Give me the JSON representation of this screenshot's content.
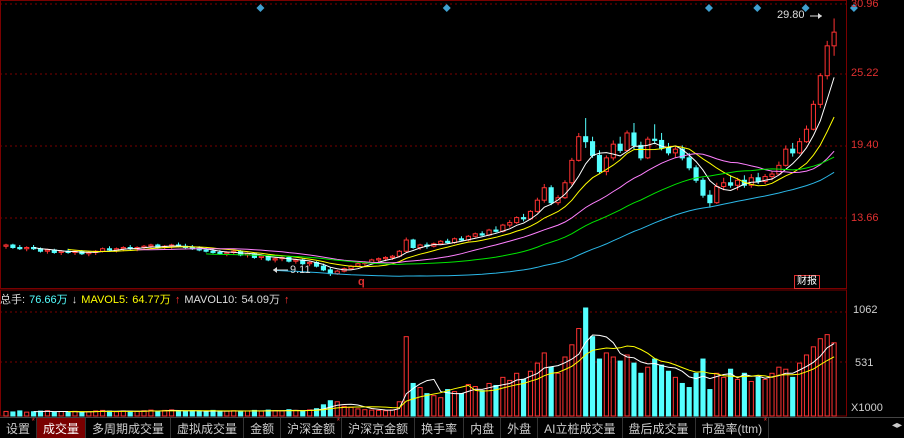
{
  "price_axis": [
    "30.96",
    "25.22",
    "19.40",
    "13.66"
  ],
  "volume_axis": [
    "1062",
    "531",
    "X1000"
  ],
  "annotations": {
    "high": "29.80",
    "low": "9.11",
    "event_marker": "q",
    "badge": "财报"
  },
  "indicator": {
    "total_label": "总手:",
    "total_value": "76.66万",
    "ma5_label": "MAVOL5:",
    "ma5_value": "64.77万",
    "ma10_label": "MAVOL10:",
    "ma10_value": "54.09万"
  },
  "tabs": [
    {
      "label": "设置",
      "star": true
    },
    {
      "label": "成交量",
      "active": true
    },
    {
      "label": "多周期成交量"
    },
    {
      "label": "虚拟成交量"
    },
    {
      "label": "金额"
    },
    {
      "label": "沪深金额",
      "star": true
    },
    {
      "label": "沪深京金额"
    },
    {
      "label": "换手率"
    },
    {
      "label": "内盘"
    },
    {
      "label": "外盘"
    },
    {
      "label": "AI立桩成交量"
    },
    {
      "label": "盘后成交量"
    },
    {
      "label": "市盈率(ttm)",
      "star": true
    }
  ],
  "nav_arrows": "◂▸",
  "colors": {
    "up": "#ff3232",
    "down": "#54ffff",
    "ma5": "#ffffff",
    "ma10": "#ffff00",
    "ma20": "#ff80ff",
    "ma30": "#00e600",
    "ma60": "#2bb8e8",
    "grid": "#7a0000",
    "diamond": "#3fa0d0"
  },
  "chart_data": {
    "type": "candlestick",
    "price_ylim": [
      9.11,
      30.96
    ],
    "volume_ylim": [
      0,
      1062
    ],
    "candles": [
      [
        11.5,
        11.7,
        11.3,
        11.6
      ],
      [
        11.6,
        11.7,
        11.3,
        11.4
      ],
      [
        11.4,
        11.6,
        11.2,
        11.3
      ],
      [
        11.3,
        11.5,
        11.1,
        11.4
      ],
      [
        11.4,
        11.6,
        11.2,
        11.3
      ],
      [
        11.3,
        11.4,
        11.0,
        11.1
      ],
      [
        11.1,
        11.3,
        10.9,
        11.2
      ],
      [
        11.2,
        11.3,
        10.9,
        11.0
      ],
      [
        11.0,
        11.2,
        10.8,
        11.1
      ],
      [
        11.1,
        11.3,
        10.9,
        11.0
      ],
      [
        11.0,
        11.2,
        10.8,
        11.1
      ],
      [
        11.1,
        11.2,
        10.8,
        10.9
      ],
      [
        10.9,
        11.1,
        10.7,
        11.0
      ],
      [
        11.0,
        11.2,
        10.8,
        11.1
      ],
      [
        11.1,
        11.4,
        11.0,
        11.3
      ],
      [
        11.3,
        11.5,
        11.1,
        11.2
      ],
      [
        11.2,
        11.4,
        11.0,
        11.3
      ],
      [
        11.3,
        11.5,
        11.1,
        11.4
      ],
      [
        11.4,
        11.6,
        11.2,
        11.3
      ],
      [
        11.3,
        11.5,
        11.1,
        11.4
      ],
      [
        11.4,
        11.6,
        11.2,
        11.5
      ],
      [
        11.5,
        11.7,
        11.3,
        11.6
      ],
      [
        11.6,
        11.7,
        11.3,
        11.4
      ],
      [
        11.4,
        11.6,
        11.2,
        11.5
      ],
      [
        11.5,
        11.7,
        11.3,
        11.6
      ],
      [
        11.6,
        11.8,
        11.4,
        11.5
      ],
      [
        11.5,
        11.7,
        11.3,
        11.4
      ],
      [
        11.4,
        11.6,
        11.2,
        11.3
      ],
      [
        11.3,
        11.5,
        11.1,
        11.2
      ],
      [
        11.2,
        11.4,
        11.0,
        11.1
      ],
      [
        11.1,
        11.3,
        10.9,
        11.0
      ],
      [
        11.0,
        11.2,
        10.8,
        10.9
      ],
      [
        10.9,
        11.1,
        10.7,
        11.0
      ],
      [
        11.0,
        11.2,
        10.8,
        11.1
      ],
      [
        11.1,
        11.2,
        10.7,
        10.8
      ],
      [
        10.8,
        11.0,
        10.6,
        10.9
      ],
      [
        10.9,
        11.0,
        10.5,
        10.6
      ],
      [
        10.6,
        10.8,
        10.4,
        10.7
      ],
      [
        10.7,
        10.8,
        10.3,
        10.4
      ],
      [
        10.4,
        10.6,
        10.2,
        10.5
      ],
      [
        10.5,
        10.7,
        10.3,
        10.6
      ],
      [
        10.6,
        10.7,
        10.2,
        10.3
      ],
      [
        10.3,
        10.5,
        10.1,
        10.4
      ],
      [
        10.4,
        10.5,
        10.0,
        10.1
      ],
      [
        10.1,
        10.3,
        9.9,
        10.2
      ],
      [
        10.2,
        10.3,
        9.8,
        9.9
      ],
      [
        9.9,
        10.1,
        9.5,
        9.6
      ],
      [
        9.6,
        9.8,
        9.11,
        9.3
      ],
      [
        9.3,
        9.6,
        9.2,
        9.5
      ],
      [
        9.5,
        9.8,
        9.4,
        9.7
      ],
      [
        9.7,
        10.0,
        9.6,
        9.9
      ],
      [
        9.9,
        10.2,
        9.8,
        10.1
      ],
      [
        10.1,
        10.3,
        9.9,
        10.2
      ],
      [
        10.2,
        10.5,
        10.1,
        10.4
      ],
      [
        10.4,
        10.6,
        10.2,
        10.5
      ],
      [
        10.5,
        10.7,
        10.3,
        10.6
      ],
      [
        10.6,
        10.8,
        10.4,
        10.7
      ],
      [
        10.7,
        11.2,
        10.6,
        11.1
      ],
      [
        11.1,
        12.2,
        11.0,
        12.0
      ],
      [
        12.0,
        12.1,
        11.3,
        11.4
      ],
      [
        11.4,
        11.7,
        11.2,
        11.6
      ],
      [
        11.6,
        11.8,
        11.3,
        11.5
      ],
      [
        11.5,
        11.8,
        11.4,
        11.7
      ],
      [
        11.7,
        12.0,
        11.6,
        11.9
      ],
      [
        11.9,
        12.1,
        11.7,
        11.8
      ],
      [
        11.8,
        12.2,
        11.7,
        12.1
      ],
      [
        12.1,
        12.3,
        11.9,
        12.0
      ],
      [
        12.0,
        12.4,
        11.9,
        12.3
      ],
      [
        12.3,
        12.6,
        12.2,
        12.5
      ],
      [
        12.5,
        12.7,
        12.3,
        12.4
      ],
      [
        12.4,
        12.9,
        12.3,
        12.8
      ],
      [
        12.8,
        13.1,
        12.6,
        12.7
      ],
      [
        12.7,
        13.3,
        12.6,
        13.2
      ],
      [
        13.2,
        13.6,
        13.0,
        13.4
      ],
      [
        13.4,
        13.9,
        13.3,
        13.8
      ],
      [
        13.8,
        14.1,
        13.5,
        13.7
      ],
      [
        13.7,
        14.4,
        13.6,
        14.3
      ],
      [
        14.3,
        15.4,
        14.2,
        15.2
      ],
      [
        15.2,
        16.5,
        15.0,
        16.2
      ],
      [
        16.2,
        16.4,
        14.8,
        15.0
      ],
      [
        15.0,
        15.6,
        14.8,
        15.4
      ],
      [
        15.4,
        16.8,
        15.3,
        16.6
      ],
      [
        16.6,
        18.6,
        16.4,
        18.4
      ],
      [
        18.4,
        20.6,
        18.3,
        20.3
      ],
      [
        20.3,
        21.8,
        19.4,
        19.9
      ],
      [
        19.9,
        20.3,
        18.6,
        18.8
      ],
      [
        18.8,
        19.2,
        17.3,
        17.5
      ],
      [
        17.5,
        18.8,
        17.2,
        18.6
      ],
      [
        18.6,
        20.0,
        18.4,
        19.7
      ],
      [
        19.7,
        20.3,
        19.0,
        19.2
      ],
      [
        19.2,
        20.8,
        19.1,
        20.6
      ],
      [
        20.6,
        21.4,
        19.3,
        19.6
      ],
      [
        19.6,
        19.9,
        18.4,
        18.6
      ],
      [
        18.6,
        20.3,
        18.5,
        20.1
      ],
      [
        20.1,
        21.3,
        19.7,
        20.0
      ],
      [
        20.0,
        20.6,
        19.2,
        19.4
      ],
      [
        19.4,
        19.8,
        18.8,
        19.0
      ],
      [
        19.0,
        19.6,
        18.6,
        19.3
      ],
      [
        19.3,
        19.6,
        18.4,
        18.6
      ],
      [
        18.6,
        19.0,
        17.6,
        17.8
      ],
      [
        17.8,
        18.0,
        16.6,
        16.8
      ],
      [
        16.8,
        17.0,
        15.4,
        15.6
      ],
      [
        15.6,
        16.0,
        14.6,
        15.0
      ],
      [
        15.0,
        16.6,
        14.9,
        16.3
      ],
      [
        16.3,
        17.0,
        16.0,
        16.6
      ],
      [
        16.6,
        17.2,
        16.2,
        16.4
      ],
      [
        16.4,
        17.0,
        16.0,
        16.8
      ],
      [
        16.8,
        17.2,
        16.2,
        16.4
      ],
      [
        16.4,
        17.3,
        16.2,
        17.0
      ],
      [
        17.0,
        17.4,
        16.5,
        16.7
      ],
      [
        16.7,
        17.3,
        16.5,
        17.1
      ],
      [
        17.1,
        17.5,
        16.8,
        17.3
      ],
      [
        17.3,
        18.3,
        17.2,
        18.0
      ],
      [
        18.0,
        19.6,
        17.9,
        19.3
      ],
      [
        19.3,
        19.8,
        18.7,
        19.0
      ],
      [
        19.0,
        20.2,
        18.9,
        19.9
      ],
      [
        19.9,
        21.2,
        19.8,
        20.9
      ],
      [
        20.9,
        23.2,
        20.8,
        22.9
      ],
      [
        22.9,
        25.4,
        22.6,
        25.2
      ],
      [
        25.2,
        28.0,
        24.9,
        27.6
      ],
      [
        27.6,
        29.8,
        26.8,
        28.7
      ]
    ],
    "volumes": [
      45,
      40,
      50,
      38,
      42,
      48,
      52,
      35,
      44,
      40,
      46,
      38,
      42,
      50,
      55,
      48,
      42,
      50,
      46,
      44,
      52,
      58,
      48,
      55,
      60,
      50,
      45,
      52,
      48,
      42,
      55,
      50,
      48,
      52,
      45,
      50,
      55,
      48,
      58,
      52,
      50,
      62,
      55,
      48,
      60,
      72,
      110,
      150,
      140,
      95,
      85,
      70,
      62,
      58,
      55,
      52,
      60,
      140,
      780,
      320,
      280,
      220,
      200,
      180,
      260,
      240,
      220,
      310,
      290,
      250,
      320,
      300,
      380,
      350,
      420,
      360,
      440,
      520,
      620,
      480,
      420,
      580,
      700,
      860,
      1062,
      780,
      560,
      620,
      580,
      540,
      600,
      520,
      420,
      480,
      560,
      500,
      440,
      380,
      320,
      280,
      420,
      560,
      260,
      420,
      380,
      460,
      360,
      420,
      340,
      380,
      360,
      420,
      480,
      460,
      380,
      520,
      600,
      680,
      760,
      800,
      720
    ],
    "diamond_markers": [
      36,
      63,
      101,
      108,
      115,
      122,
      174,
      175
    ]
  }
}
